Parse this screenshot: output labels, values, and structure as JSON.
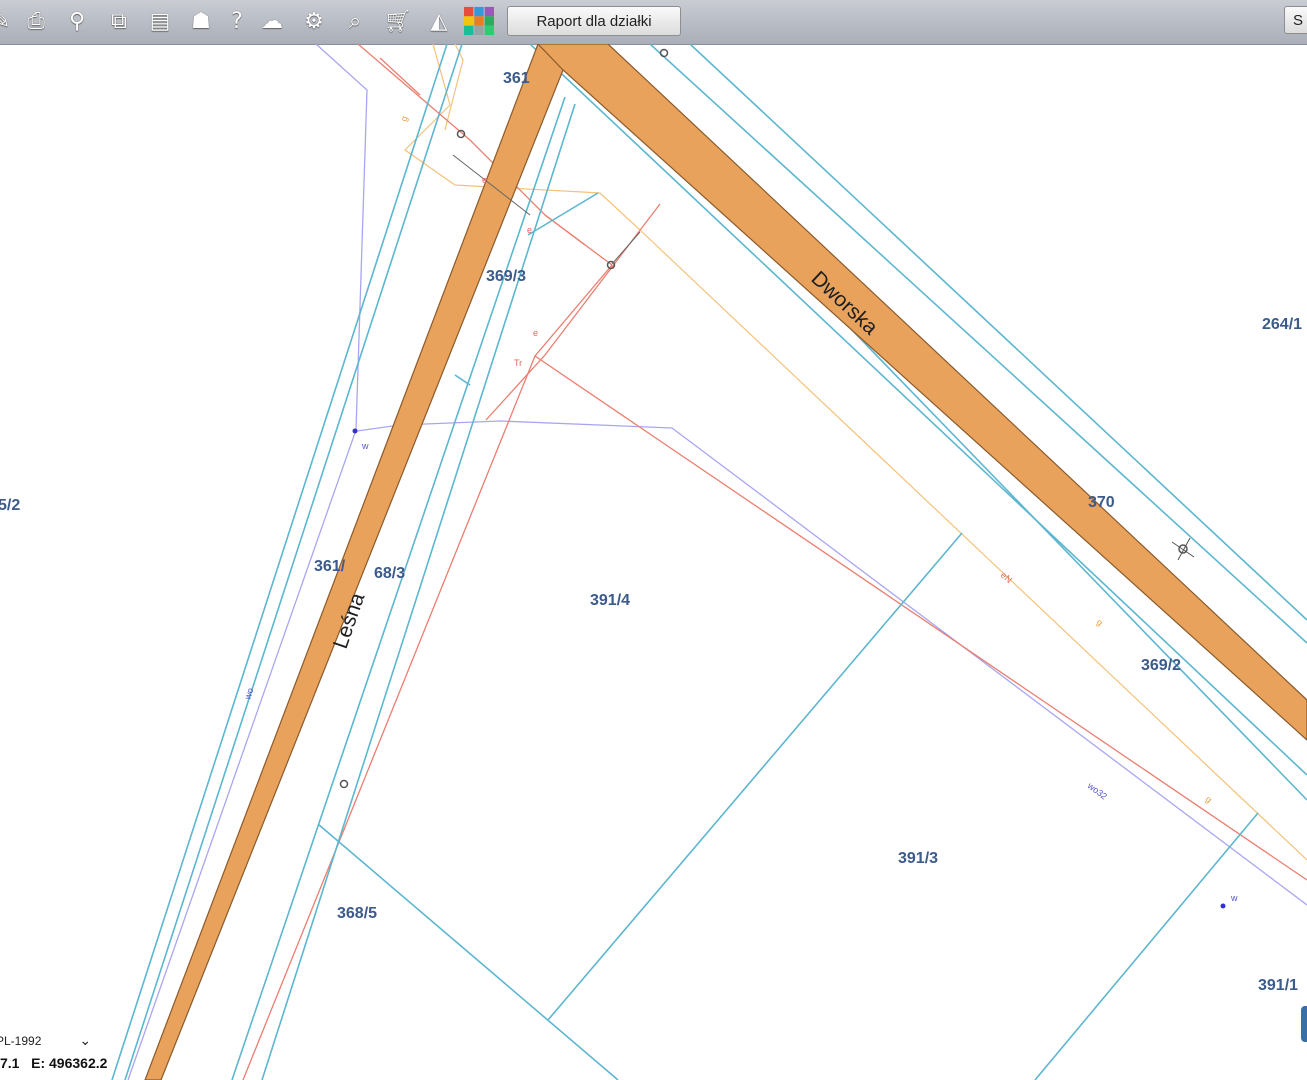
{
  "toolbar": {
    "icons": [
      "edit-icon",
      "print-icon",
      "location-pin-icon",
      "copy-icon",
      "layout-icon",
      "shape-icon",
      "help-icon",
      "cloud-upload-icon",
      "settings-icon",
      "zoom-icon",
      "cart-icon",
      "measure-icon",
      "layers-icon"
    ],
    "report_button": "Raport dla działki",
    "search_button": "S"
  },
  "map": {
    "streets": {
      "lesna": "Leśna",
      "dworska": "Dworska"
    },
    "parcels": {
      "p361_top": "361",
      "p369_3": "369/3",
      "p264_1": "264/1",
      "p5_2": "5/2",
      "p370": "370",
      "p361_mid": "361/",
      "p68_3": "68/3",
      "p391_4": "391/4",
      "p369_2": "369/2",
      "p391_3": "391/3",
      "p368_5": "368/5",
      "p391_1": "391/1"
    },
    "utility_labels": {
      "w1": "w",
      "w2": "w",
      "wo": "wo",
      "wo32": "wo32",
      "e1": "e",
      "e2": "e",
      "e3": "e",
      "tr": "Tr",
      "en": "eN",
      "g1": "g",
      "g2": "g",
      "g3": "g"
    }
  },
  "status": {
    "crs": "PL-1992",
    "coords": "7.1   E: 496362.2"
  }
}
